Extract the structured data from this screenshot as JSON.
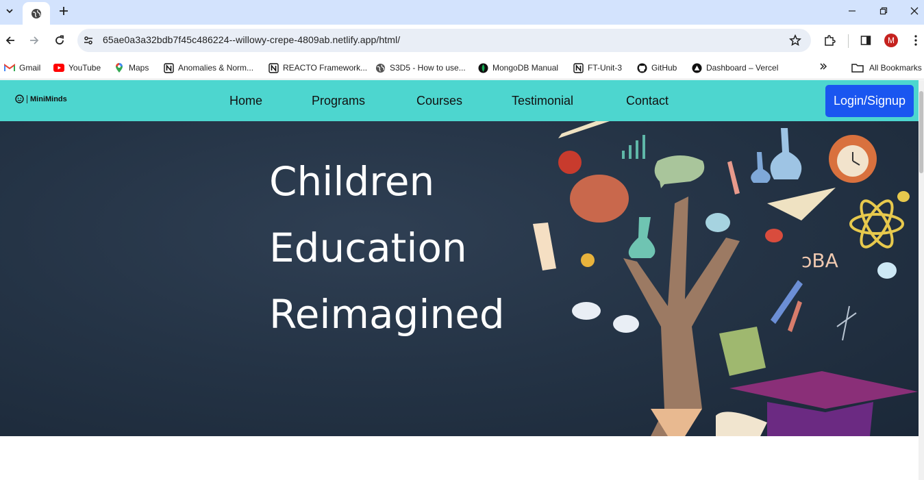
{
  "browser": {
    "url": "65ae0a3a32bdb7f45c486224--willowy-crepe-4809ab.netlify.app/html/",
    "profile_initial": "M",
    "bookmarks": [
      {
        "label": "Gmail",
        "icon": "gmail-icon"
      },
      {
        "label": "YouTube",
        "icon": "youtube-icon"
      },
      {
        "label": "Maps",
        "icon": "maps-icon"
      },
      {
        "label": "Anomalies & Norm...",
        "icon": "notion-icon"
      },
      {
        "label": "REACTO Framework...",
        "icon": "notion-icon"
      },
      {
        "label": "S3D5 - How to use...",
        "icon": "globe-icon"
      },
      {
        "label": "MongoDB Manual",
        "icon": "mongodb-icon"
      },
      {
        "label": "FT-Unit-3",
        "icon": "notion-icon"
      },
      {
        "label": "GitHub",
        "icon": "github-icon"
      },
      {
        "label": "Dashboard – Vercel",
        "icon": "vercel-icon"
      }
    ],
    "all_bookmarks_label": "All Bookmarks"
  },
  "site": {
    "logo_text": "MiniMinds",
    "nav": [
      "Home",
      "Programs",
      "Courses",
      "Testimonial",
      "Contact"
    ],
    "login_label": "Login/Signup",
    "hero_lines": [
      "Children",
      "Education",
      "Reimagined"
    ]
  },
  "colors": {
    "nav_bg": "#4dd6cf",
    "login_bg": "#1a56f0",
    "hero_bg": "#243345"
  }
}
